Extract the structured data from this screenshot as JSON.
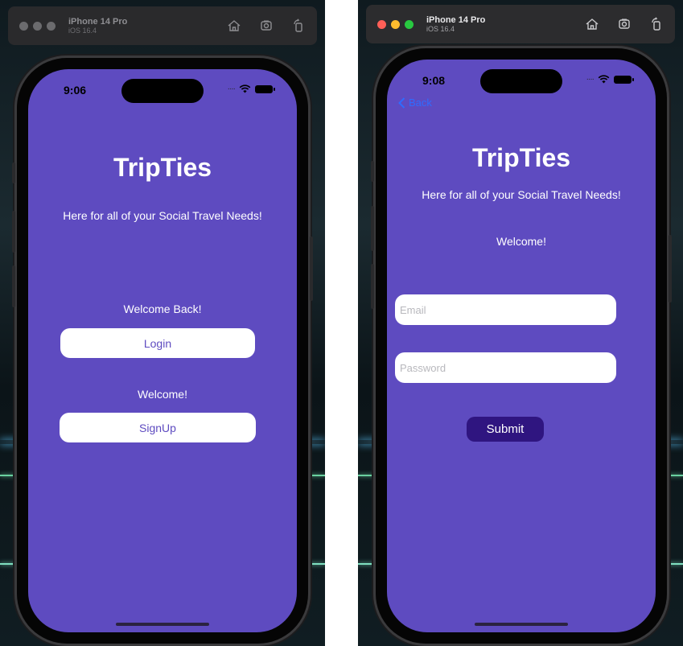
{
  "simulator": {
    "device_name": "iPhone 14 Pro",
    "os_version": "iOS 16.4",
    "toolbar_icons": [
      "home-icon",
      "screenshot-icon",
      "rotate-icon"
    ]
  },
  "left_screen": {
    "status_time": "9:06",
    "app_title": "TripTies",
    "tagline": "Here for all of your Social Travel Needs!",
    "welcome_back_label": "Welcome Back!",
    "login_button": "Login",
    "welcome_label": "Welcome!",
    "signup_button": "SignUp"
  },
  "right_screen": {
    "status_time": "9:08",
    "back_label": "Back",
    "app_title": "TripTies",
    "tagline": "Here for all of your Social Travel Needs!",
    "welcome_label": "Welcome!",
    "email_placeholder": "Email",
    "email_value": "",
    "password_placeholder": "Password",
    "password_value": "",
    "submit_button": "Submit"
  },
  "colors": {
    "screen_background": "#5e4bc0",
    "button_background": "#ffffff",
    "button_text": "#5e4bc0",
    "submit_background": "#2f1580",
    "back_link": "#2f6bff"
  }
}
